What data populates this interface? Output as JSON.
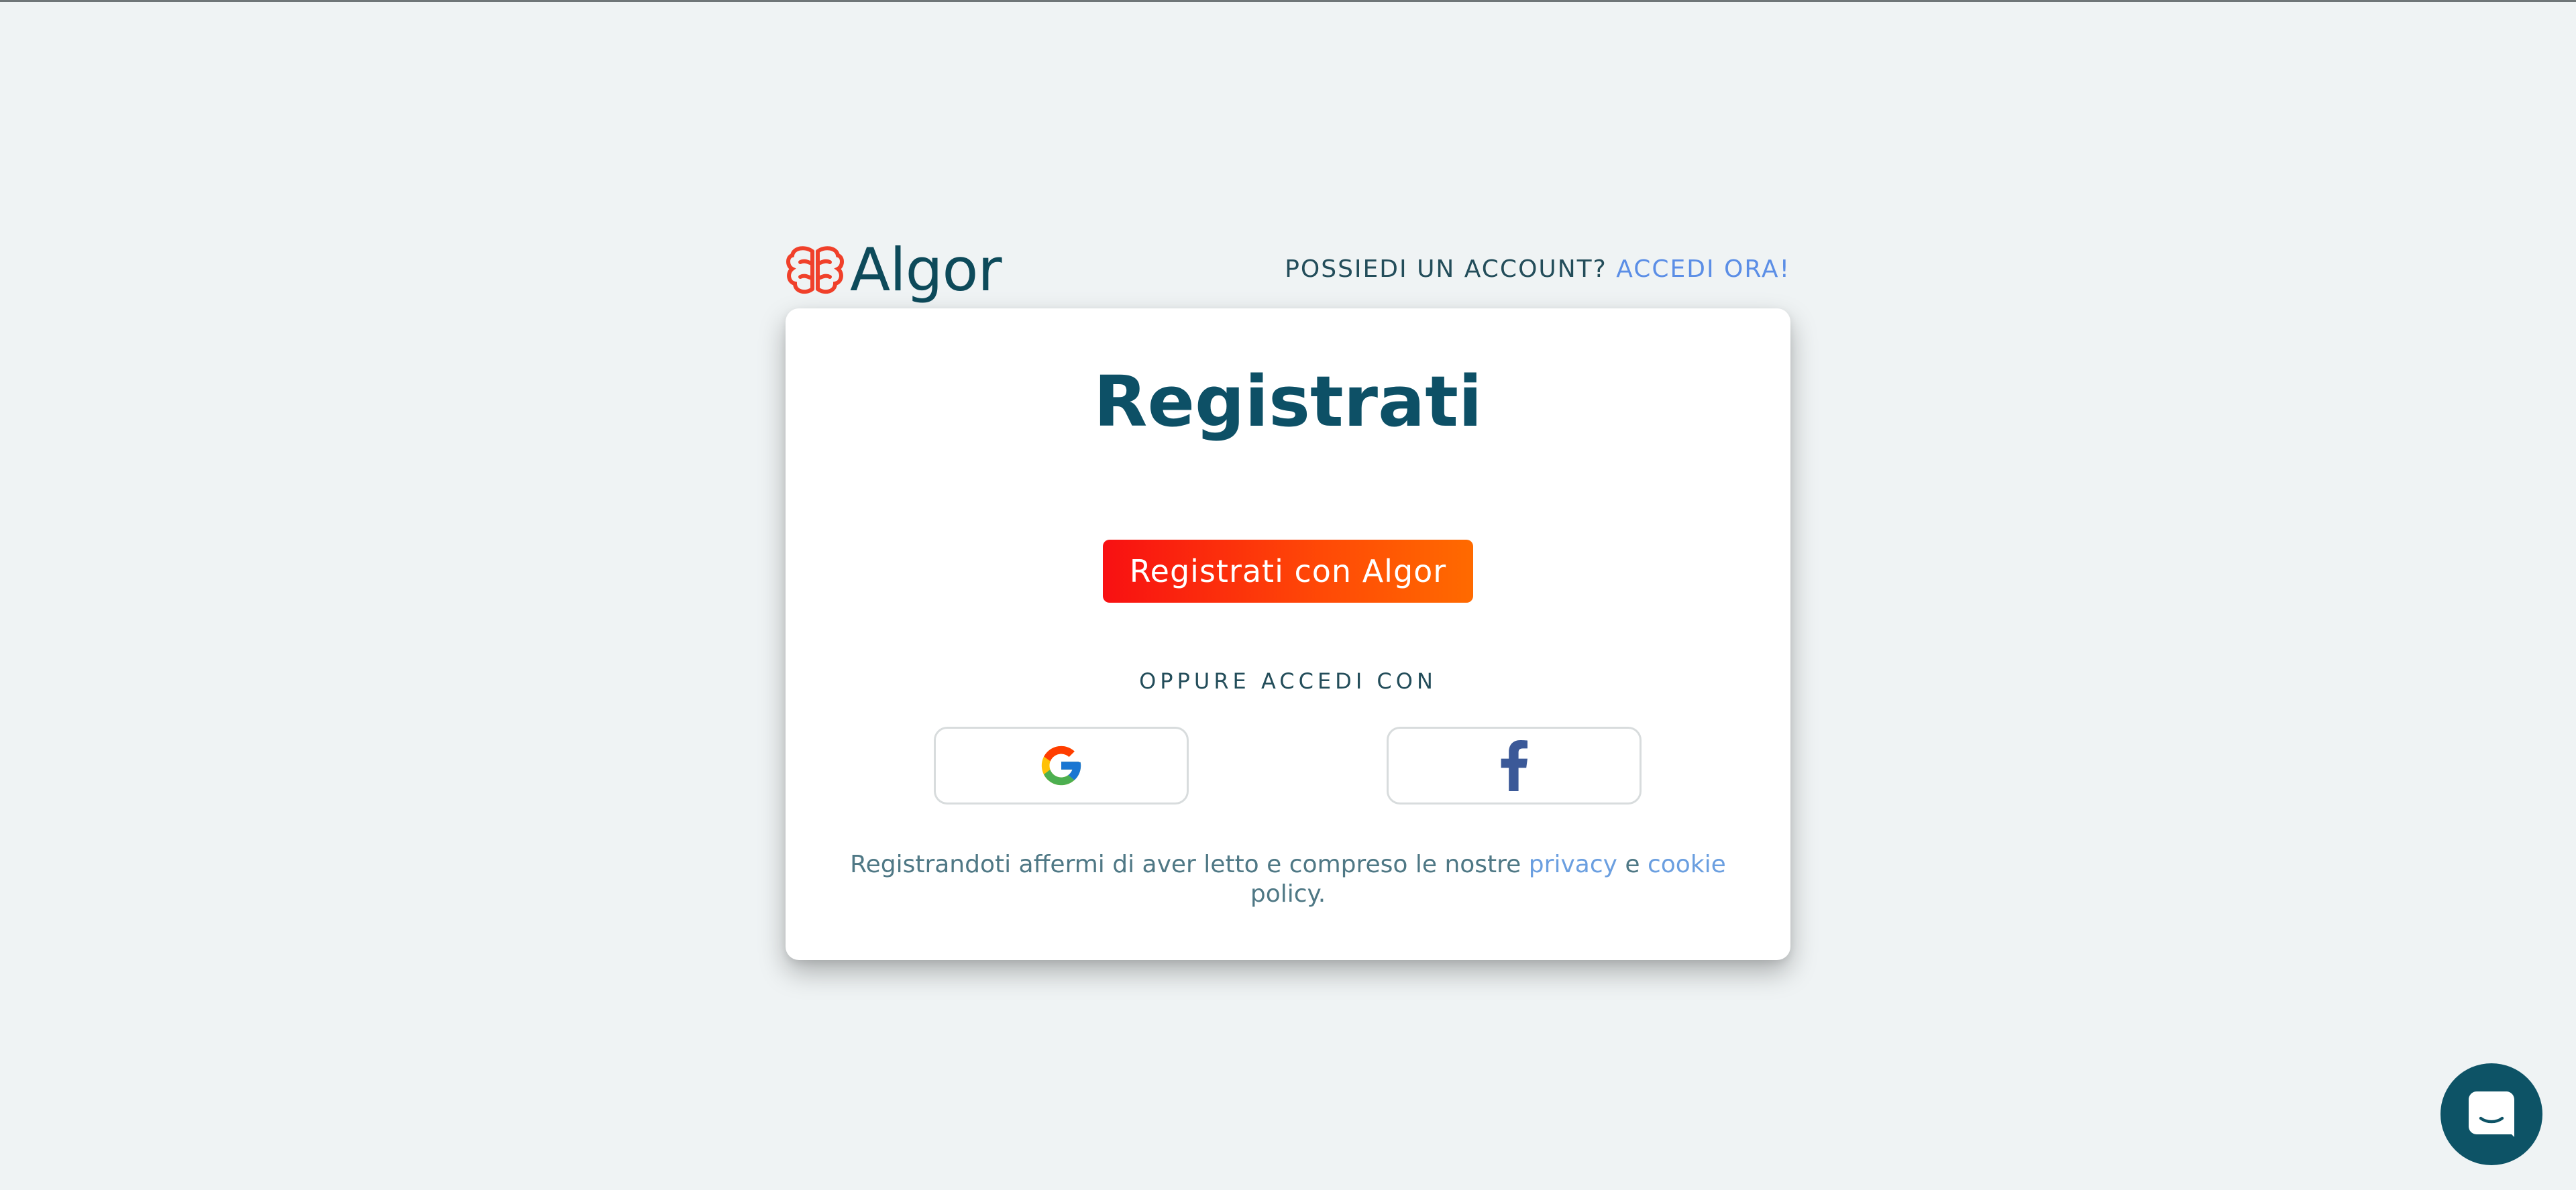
{
  "logo": {
    "text": "Algor",
    "icon": "algor-brain-icon",
    "colors": {
      "mark": "#f0402a",
      "text": "#0d4a5a"
    }
  },
  "account_prompt": {
    "question": "POSSIEDI UN ACCOUNT?",
    "link": "ACCEDI ORA!"
  },
  "card": {
    "title": "Registrati",
    "primary_button": "Registrati con Algor",
    "or_label": "OPPURE ACCEDI CON",
    "social": [
      {
        "name": "google",
        "icon": "google-icon"
      },
      {
        "name": "facebook",
        "icon": "facebook-icon"
      }
    ],
    "legal": {
      "prefix": "Registrandoti affermi di aver letto e compreso le nostre",
      "privacy": "privacy",
      "conj": "e",
      "cookie": "cookie",
      "policy": "policy."
    }
  },
  "chat": {
    "icon": "chat-bubble-icon"
  },
  "colors": {
    "background": "#eff3f4",
    "primary": "#f81012",
    "primary_end": "#ff6a00",
    "title": "#0d5066",
    "link": "#5b8ee6",
    "chat": "#0d5366"
  }
}
